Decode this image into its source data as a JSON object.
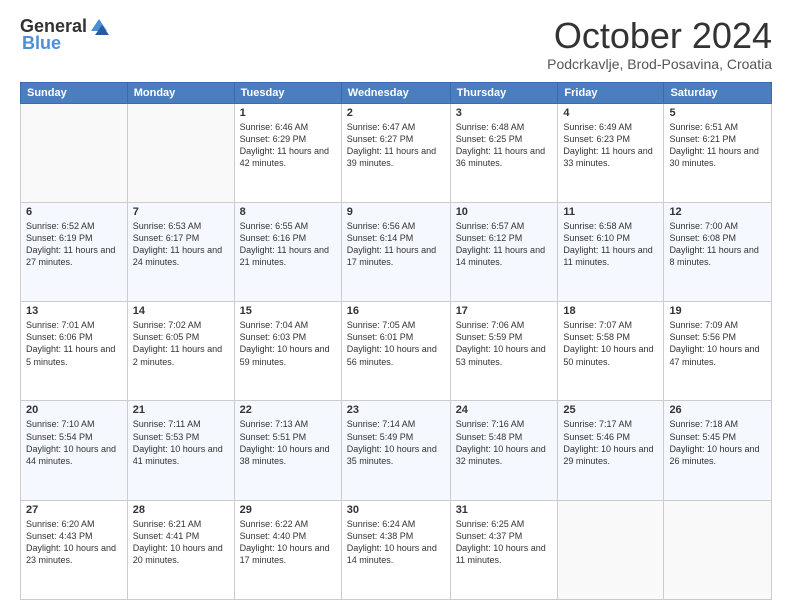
{
  "logo": {
    "general": "General",
    "blue": "Blue"
  },
  "header": {
    "month": "October 2024",
    "location": "Podcrkavlje, Brod-Posavina, Croatia"
  },
  "weekdays": [
    "Sunday",
    "Monday",
    "Tuesday",
    "Wednesday",
    "Thursday",
    "Friday",
    "Saturday"
  ],
  "weeks": [
    [
      {
        "day": "",
        "info": ""
      },
      {
        "day": "",
        "info": ""
      },
      {
        "day": "1",
        "info": "Sunrise: 6:46 AM\nSunset: 6:29 PM\nDaylight: 11 hours and 42 minutes."
      },
      {
        "day": "2",
        "info": "Sunrise: 6:47 AM\nSunset: 6:27 PM\nDaylight: 11 hours and 39 minutes."
      },
      {
        "day": "3",
        "info": "Sunrise: 6:48 AM\nSunset: 6:25 PM\nDaylight: 11 hours and 36 minutes."
      },
      {
        "day": "4",
        "info": "Sunrise: 6:49 AM\nSunset: 6:23 PM\nDaylight: 11 hours and 33 minutes."
      },
      {
        "day": "5",
        "info": "Sunrise: 6:51 AM\nSunset: 6:21 PM\nDaylight: 11 hours and 30 minutes."
      }
    ],
    [
      {
        "day": "6",
        "info": "Sunrise: 6:52 AM\nSunset: 6:19 PM\nDaylight: 11 hours and 27 minutes."
      },
      {
        "day": "7",
        "info": "Sunrise: 6:53 AM\nSunset: 6:17 PM\nDaylight: 11 hours and 24 minutes."
      },
      {
        "day": "8",
        "info": "Sunrise: 6:55 AM\nSunset: 6:16 PM\nDaylight: 11 hours and 21 minutes."
      },
      {
        "day": "9",
        "info": "Sunrise: 6:56 AM\nSunset: 6:14 PM\nDaylight: 11 hours and 17 minutes."
      },
      {
        "day": "10",
        "info": "Sunrise: 6:57 AM\nSunset: 6:12 PM\nDaylight: 11 hours and 14 minutes."
      },
      {
        "day": "11",
        "info": "Sunrise: 6:58 AM\nSunset: 6:10 PM\nDaylight: 11 hours and 11 minutes."
      },
      {
        "day": "12",
        "info": "Sunrise: 7:00 AM\nSunset: 6:08 PM\nDaylight: 11 hours and 8 minutes."
      }
    ],
    [
      {
        "day": "13",
        "info": "Sunrise: 7:01 AM\nSunset: 6:06 PM\nDaylight: 11 hours and 5 minutes."
      },
      {
        "day": "14",
        "info": "Sunrise: 7:02 AM\nSunset: 6:05 PM\nDaylight: 11 hours and 2 minutes."
      },
      {
        "day": "15",
        "info": "Sunrise: 7:04 AM\nSunset: 6:03 PM\nDaylight: 10 hours and 59 minutes."
      },
      {
        "day": "16",
        "info": "Sunrise: 7:05 AM\nSunset: 6:01 PM\nDaylight: 10 hours and 56 minutes."
      },
      {
        "day": "17",
        "info": "Sunrise: 7:06 AM\nSunset: 5:59 PM\nDaylight: 10 hours and 53 minutes."
      },
      {
        "day": "18",
        "info": "Sunrise: 7:07 AM\nSunset: 5:58 PM\nDaylight: 10 hours and 50 minutes."
      },
      {
        "day": "19",
        "info": "Sunrise: 7:09 AM\nSunset: 5:56 PM\nDaylight: 10 hours and 47 minutes."
      }
    ],
    [
      {
        "day": "20",
        "info": "Sunrise: 7:10 AM\nSunset: 5:54 PM\nDaylight: 10 hours and 44 minutes."
      },
      {
        "day": "21",
        "info": "Sunrise: 7:11 AM\nSunset: 5:53 PM\nDaylight: 10 hours and 41 minutes."
      },
      {
        "day": "22",
        "info": "Sunrise: 7:13 AM\nSunset: 5:51 PM\nDaylight: 10 hours and 38 minutes."
      },
      {
        "day": "23",
        "info": "Sunrise: 7:14 AM\nSunset: 5:49 PM\nDaylight: 10 hours and 35 minutes."
      },
      {
        "day": "24",
        "info": "Sunrise: 7:16 AM\nSunset: 5:48 PM\nDaylight: 10 hours and 32 minutes."
      },
      {
        "day": "25",
        "info": "Sunrise: 7:17 AM\nSunset: 5:46 PM\nDaylight: 10 hours and 29 minutes."
      },
      {
        "day": "26",
        "info": "Sunrise: 7:18 AM\nSunset: 5:45 PM\nDaylight: 10 hours and 26 minutes."
      }
    ],
    [
      {
        "day": "27",
        "info": "Sunrise: 6:20 AM\nSunset: 4:43 PM\nDaylight: 10 hours and 23 minutes."
      },
      {
        "day": "28",
        "info": "Sunrise: 6:21 AM\nSunset: 4:41 PM\nDaylight: 10 hours and 20 minutes."
      },
      {
        "day": "29",
        "info": "Sunrise: 6:22 AM\nSunset: 4:40 PM\nDaylight: 10 hours and 17 minutes."
      },
      {
        "day": "30",
        "info": "Sunrise: 6:24 AM\nSunset: 4:38 PM\nDaylight: 10 hours and 14 minutes."
      },
      {
        "day": "31",
        "info": "Sunrise: 6:25 AM\nSunset: 4:37 PM\nDaylight: 10 hours and 11 minutes."
      },
      {
        "day": "",
        "info": ""
      },
      {
        "day": "",
        "info": ""
      }
    ]
  ]
}
